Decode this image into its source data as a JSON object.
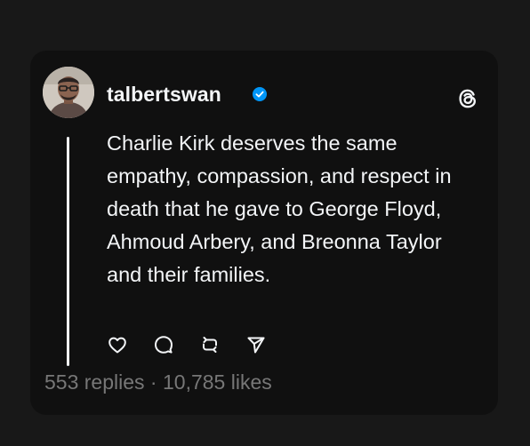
{
  "post": {
    "username": "talbertswan",
    "verified_icon": "verified-badge-icon",
    "text": "Charlie Kirk deserves the same empathy, compassion, and respect in death that he gave to George Floyd, Ahmoud Arbery, and Breonna Taylor and their families.",
    "replies_count": "553 replies",
    "separator": "·",
    "likes_count": "10,785 likes"
  },
  "icons": {
    "brand": "threads-logo-icon",
    "like": "heart-icon",
    "reply": "comment-icon",
    "repost": "repost-icon",
    "share": "send-icon"
  },
  "colors": {
    "page_background": "#181818",
    "card_background": "#101010",
    "text_primary": "#f3f5f7",
    "text_muted": "#777777",
    "verified_blue": "#0095f6"
  }
}
